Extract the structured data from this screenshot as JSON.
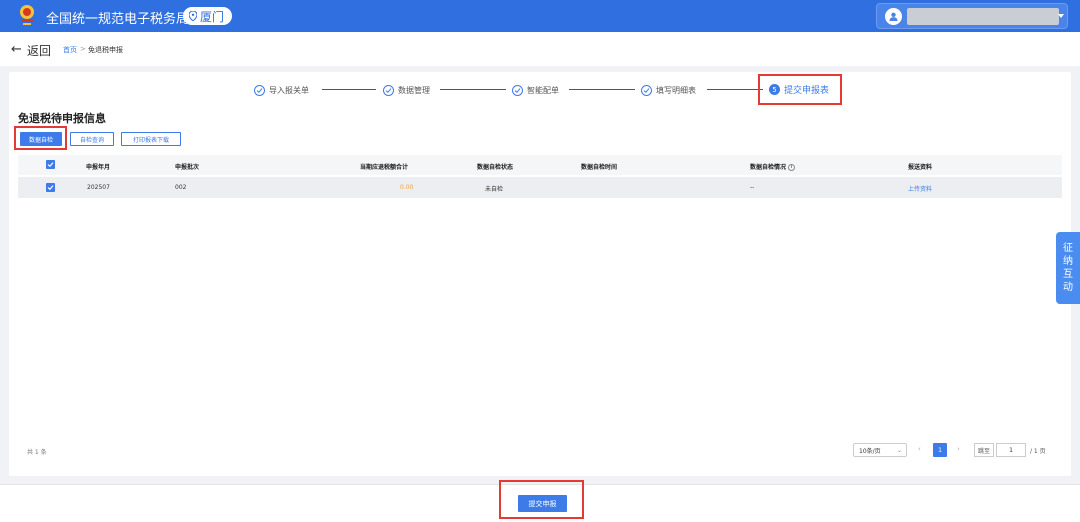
{
  "header": {
    "app_title": "全国统一规范电子税务局",
    "region": "厦门"
  },
  "breadcrumb": {
    "back_label": "返回",
    "home": "首页",
    "separator": ">",
    "current": "免退税申报"
  },
  "steps": [
    {
      "label": "导入报关单"
    },
    {
      "label": "数据管理"
    },
    {
      "label": "智能配单"
    },
    {
      "label": "填写明细表"
    }
  ],
  "active_step": {
    "number": "5",
    "label": "提交申报表"
  },
  "section_title": "免退税待申报信息",
  "buttons": {
    "self_check": "数据自检",
    "check_query": "自检查询",
    "print_download": "打印报表下载"
  },
  "table": {
    "headers": [
      "申报年月",
      "申报批次",
      "当期应退税额合计",
      "数据自检状态",
      "数据自检时间",
      "数据自检情况",
      "报送资料"
    ],
    "rows": [
      {
        "period": "202507",
        "batch": "002",
        "amount": "0.00",
        "status": "未自检",
        "time": "",
        "situation": "--",
        "materials": "上传资料"
      }
    ]
  },
  "pagination": {
    "total": "共 1 条",
    "page_size": "10条/页",
    "current_page": "1",
    "jump_label": "跳至",
    "jump_value": "1",
    "total_pages": "/ 1 页"
  },
  "side_tab": [
    "征",
    "纳",
    "互",
    "动"
  ],
  "submit_label": "提交申报",
  "colors": {
    "header": "#2f6fe0",
    "primary": "#3d7be9",
    "highlight": "#e53935",
    "amount": "#f5a033"
  }
}
